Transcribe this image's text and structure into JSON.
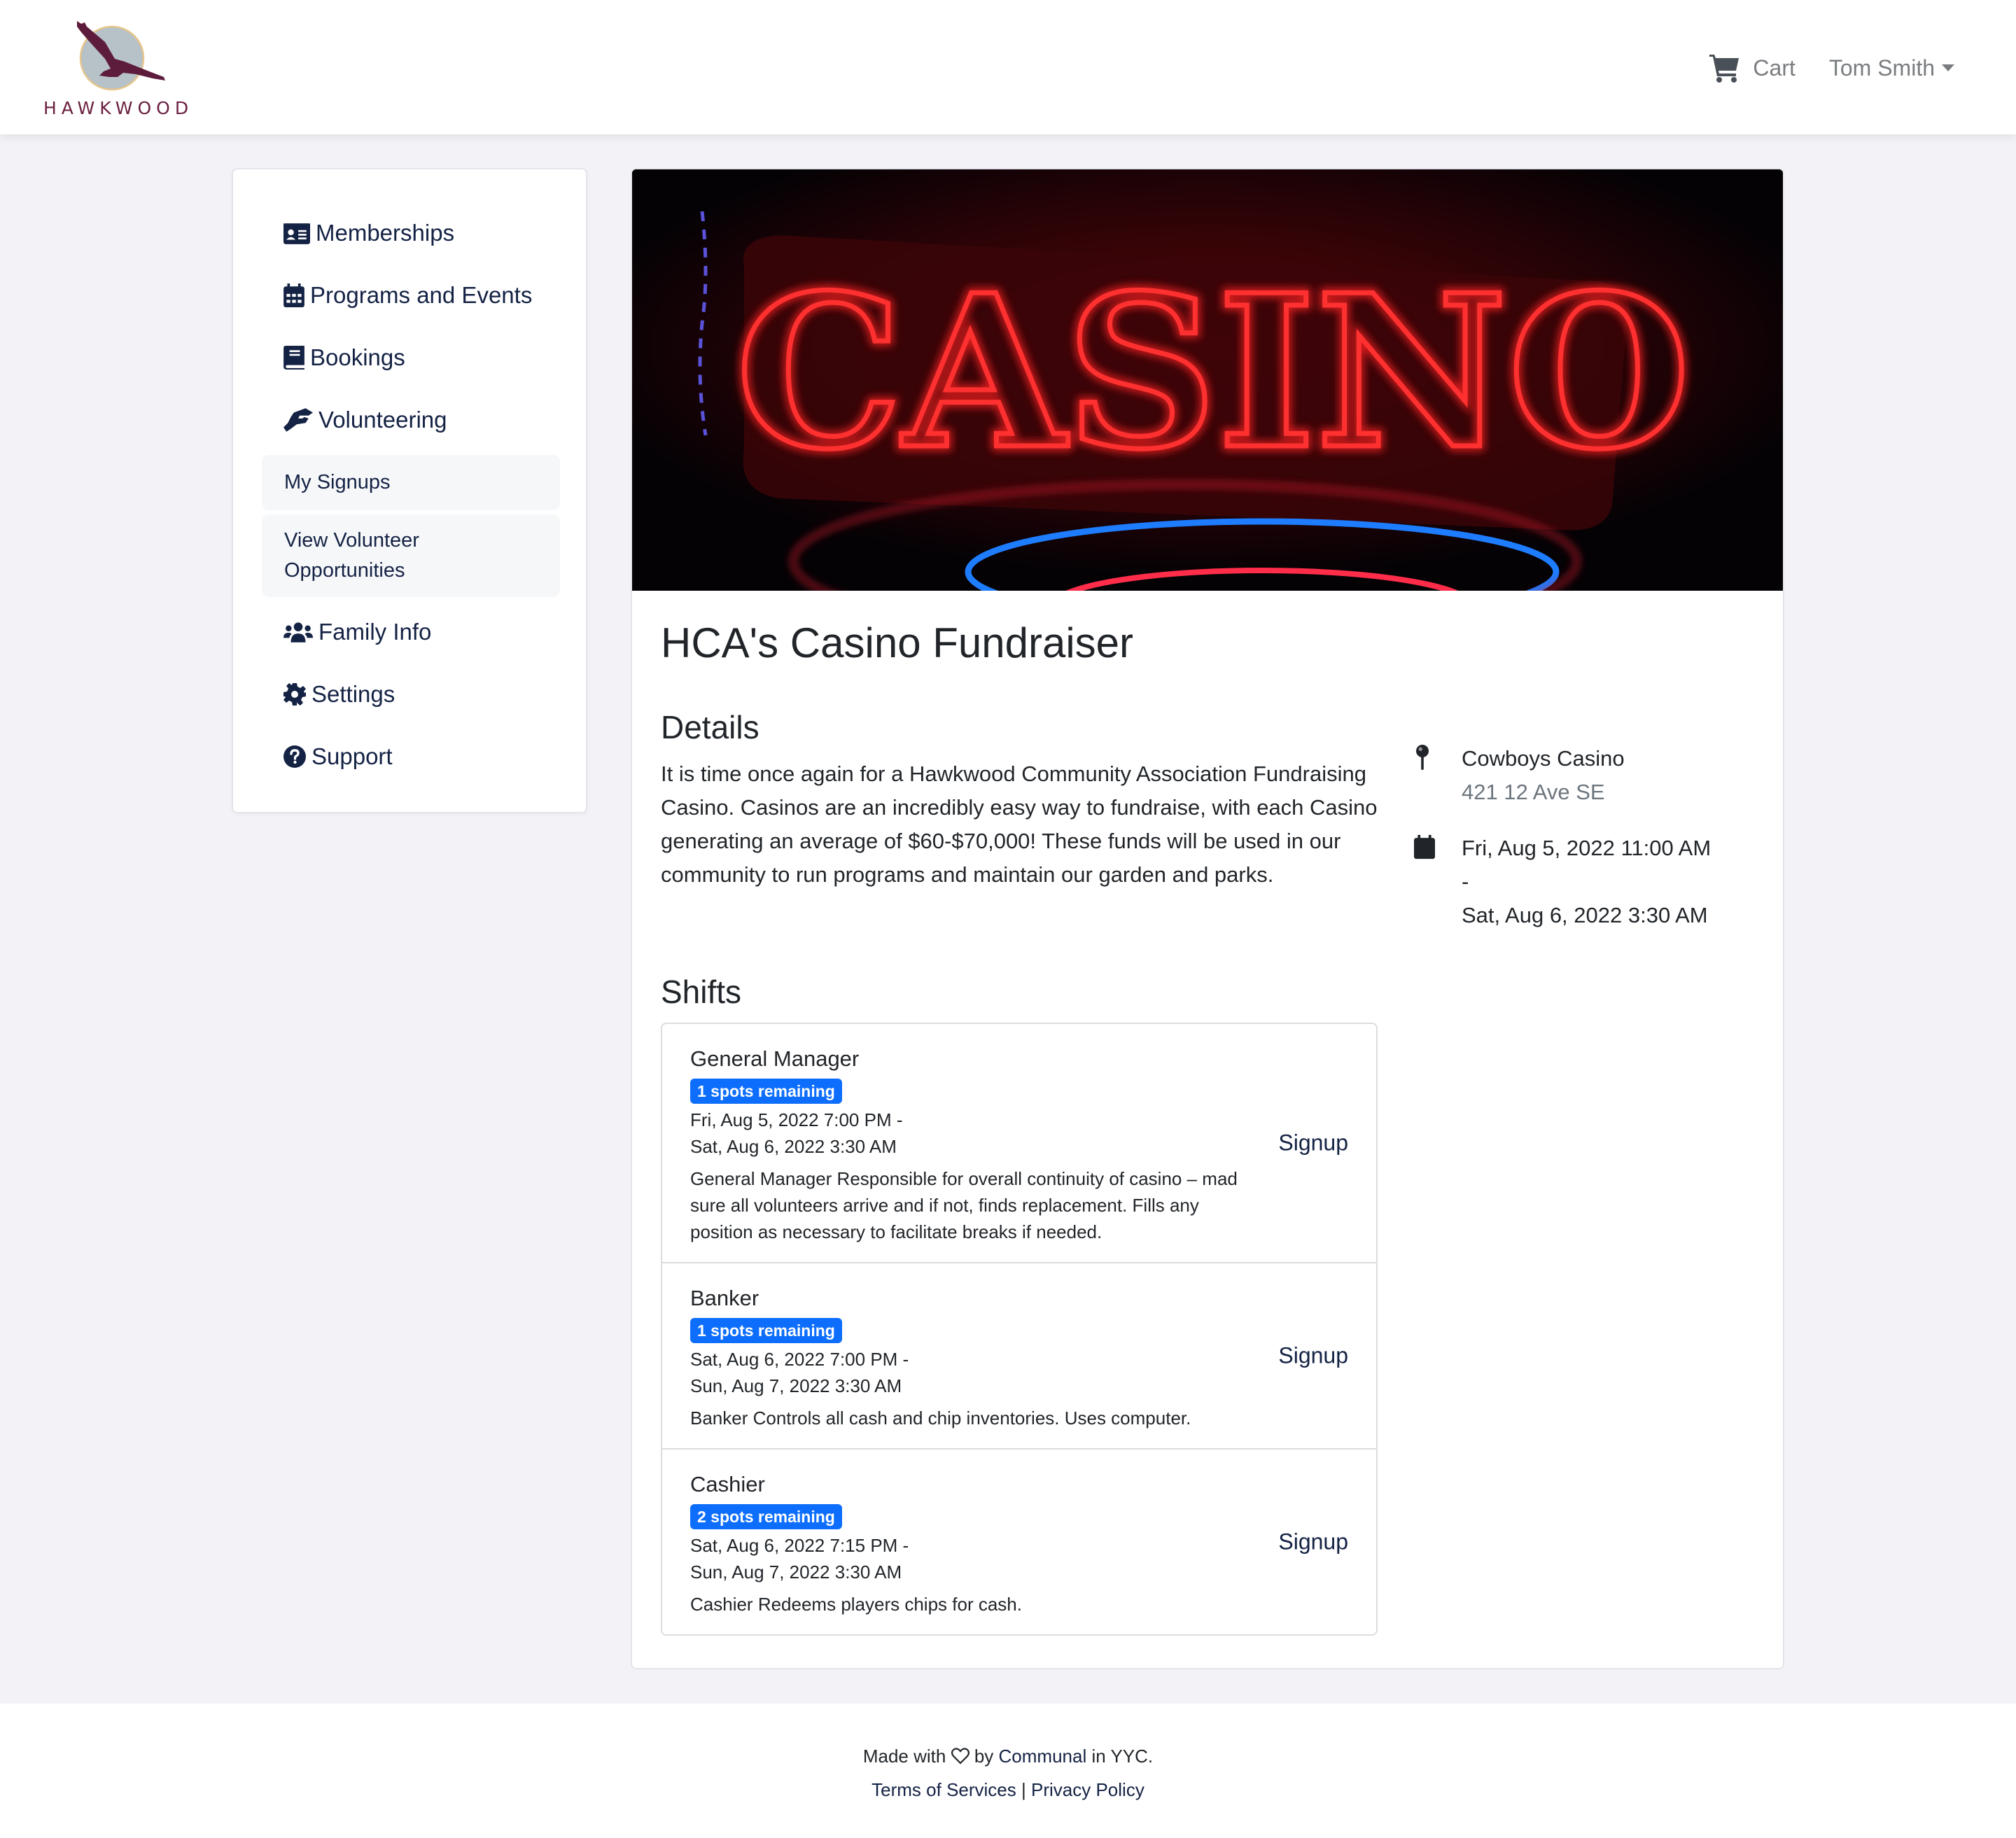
{
  "header": {
    "logo_text": "HAWKWOOD",
    "cart_label": "Cart",
    "user_name": "Tom Smith"
  },
  "sidebar": {
    "items": [
      {
        "label": "Memberships",
        "icon": "id-card-icon"
      },
      {
        "label": "Programs and Events",
        "icon": "calendar-icon"
      },
      {
        "label": "Bookings",
        "icon": "book-icon"
      },
      {
        "label": "Volunteering",
        "icon": "hands-helping-icon"
      },
      {
        "label": "Family Info",
        "icon": "users-icon"
      },
      {
        "label": "Settings",
        "icon": "gear-icon"
      },
      {
        "label": "Support",
        "icon": "question-circle-icon"
      }
    ],
    "sub_items": [
      {
        "label": "My Signups"
      },
      {
        "label": "View Volunteer Opportunities"
      }
    ]
  },
  "event": {
    "banner_text": "CASINO",
    "title": "HCA's Casino Fundraiser",
    "details_heading": "Details",
    "description": "It is time once again for a Hawkwood Community Association Fundraising Casino. Casinos are an incredibly easy way to fundraise, with each Casino generating an average of $60-$70,000! These funds will be used in our community to run programs and maintain our garden and parks.",
    "location_name": "Cowboys Casino",
    "location_address": "421 12 Ave SE",
    "start": "Fri, Aug 5, 2022 11:00 AM",
    "separator": "-",
    "end": "Sat, Aug 6, 2022 3:30 AM",
    "shifts_heading": "Shifts"
  },
  "shifts": [
    {
      "name": "General Manager",
      "badge": "1 spots remaining",
      "start": "Fri, Aug 5, 2022 7:00 PM -",
      "end": "Sat, Aug 6, 2022 3:30 AM",
      "description": "General Manager Responsible for overall continuity of casino – mad sure all volunteers arrive and if not, finds replacement. Fills any position as necessary to facilitate breaks if needed.",
      "action": "Signup"
    },
    {
      "name": "Banker",
      "badge": "1 spots remaining",
      "start": "Sat, Aug 6, 2022 7:00 PM -",
      "end": "Sun, Aug 7, 2022 3:30 AM",
      "description": "Banker Controls all cash and chip inventories. Uses computer.",
      "action": "Signup"
    },
    {
      "name": "Cashier",
      "badge": "2 spots remaining",
      "start": "Sat, Aug 6, 2022 7:15 PM -",
      "end": "Sun, Aug 7, 2022 3:30 AM",
      "description": "Cashier Redeems players chips for cash.",
      "action": "Signup"
    }
  ],
  "footer": {
    "made_with": "Made with",
    "by": "by",
    "company": "Communal",
    "location": "in YYC.",
    "terms": "Terms of Services",
    "divider": "|",
    "privacy": "Privacy Policy"
  },
  "colors": {
    "brand": "#6a1f3f",
    "nav_text": "#142244",
    "badge": "#0d6efd",
    "page_bg": "#f3f3f7"
  }
}
